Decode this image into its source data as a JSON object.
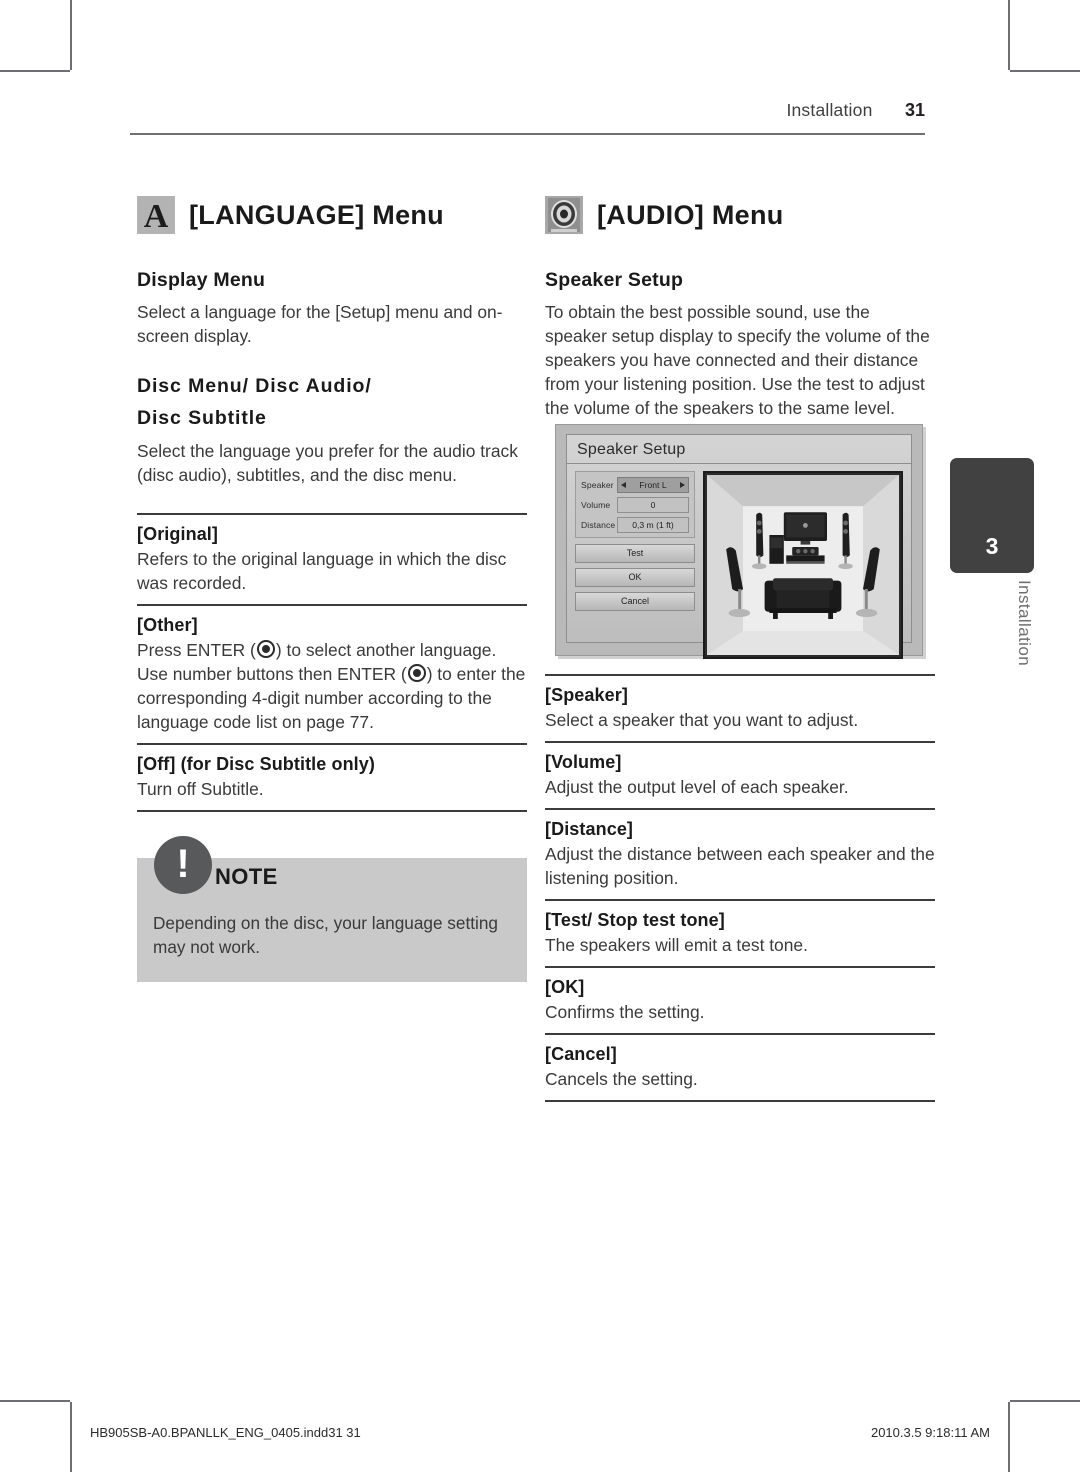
{
  "header": {
    "section": "Installation",
    "page_number": "31"
  },
  "left_column": {
    "heading": {
      "icon": "language-letter-a-icon",
      "title": "[LANGUAGE] Menu"
    },
    "display_menu": {
      "title": "Display Menu",
      "body": "Select a language for the [Setup] menu and on-screen display."
    },
    "disc_menu": {
      "title_line1": "Disc Menu/ Disc Audio/",
      "title_line2": "Disc Subtitle",
      "body": "Select the language you prefer for the audio track (disc audio), subtitles, and the disc menu."
    },
    "definitions": [
      {
        "term": "[Original]",
        "desc": "Refers to the original language in which the disc was recorded."
      },
      {
        "term": "[Other]",
        "desc_part1": "Press ENTER (",
        "desc_part2": ") to select another language. Use number buttons then ENTER (",
        "desc_part3": ") to enter the corresponding 4-digit number according to the language code list on page 77."
      },
      {
        "term": "[Off] (for Disc Subtitle only)",
        "desc": "Turn off Subtitle."
      }
    ],
    "note": {
      "badge": "!",
      "label": "NOTE",
      "text": "Depending on the disc, your language setting may not work."
    }
  },
  "right_column": {
    "heading": {
      "icon": "audio-speaker-icon",
      "title": "[AUDIO] Menu"
    },
    "speaker_setup": {
      "title": "Speaker Setup",
      "body": "To obtain the best possible sound, use the speaker setup display to specify the volume of the speakers you have connected and their distance from your listening position. Use the test to adjust the volume of the speakers to the same level."
    },
    "screenshot": {
      "window_title": "Speaker Setup",
      "fields": [
        {
          "label": "Speaker",
          "value": "Front L",
          "selected": true
        },
        {
          "label": "Volume",
          "value": "0",
          "selected": false
        },
        {
          "label": "Distance",
          "value": "0,3 m (1 ft)",
          "selected": false
        }
      ],
      "buttons": [
        "Test",
        "OK",
        "Cancel"
      ]
    },
    "definitions": [
      {
        "term": "[Speaker]",
        "desc": "Select a speaker that you want to adjust."
      },
      {
        "term": "[Volume]",
        "desc": "Adjust the output level of each speaker."
      },
      {
        "term": "[Distance]",
        "desc": "Adjust the distance between each speaker and the listening position."
      },
      {
        "term": "[Test/ Stop test tone]",
        "desc": "The speakers will emit a test tone."
      },
      {
        "term": "[OK]",
        "desc": "Confirms the setting."
      },
      {
        "term": "[Cancel]",
        "desc": "Cancels the setting."
      }
    ]
  },
  "side_tab": {
    "number": "3",
    "label": "Installation"
  },
  "footer": {
    "left": "HB905SB-A0.BPANLLK_ENG_0405.indd31   31",
    "right": "2010.3.5   9:18:11 AM"
  }
}
